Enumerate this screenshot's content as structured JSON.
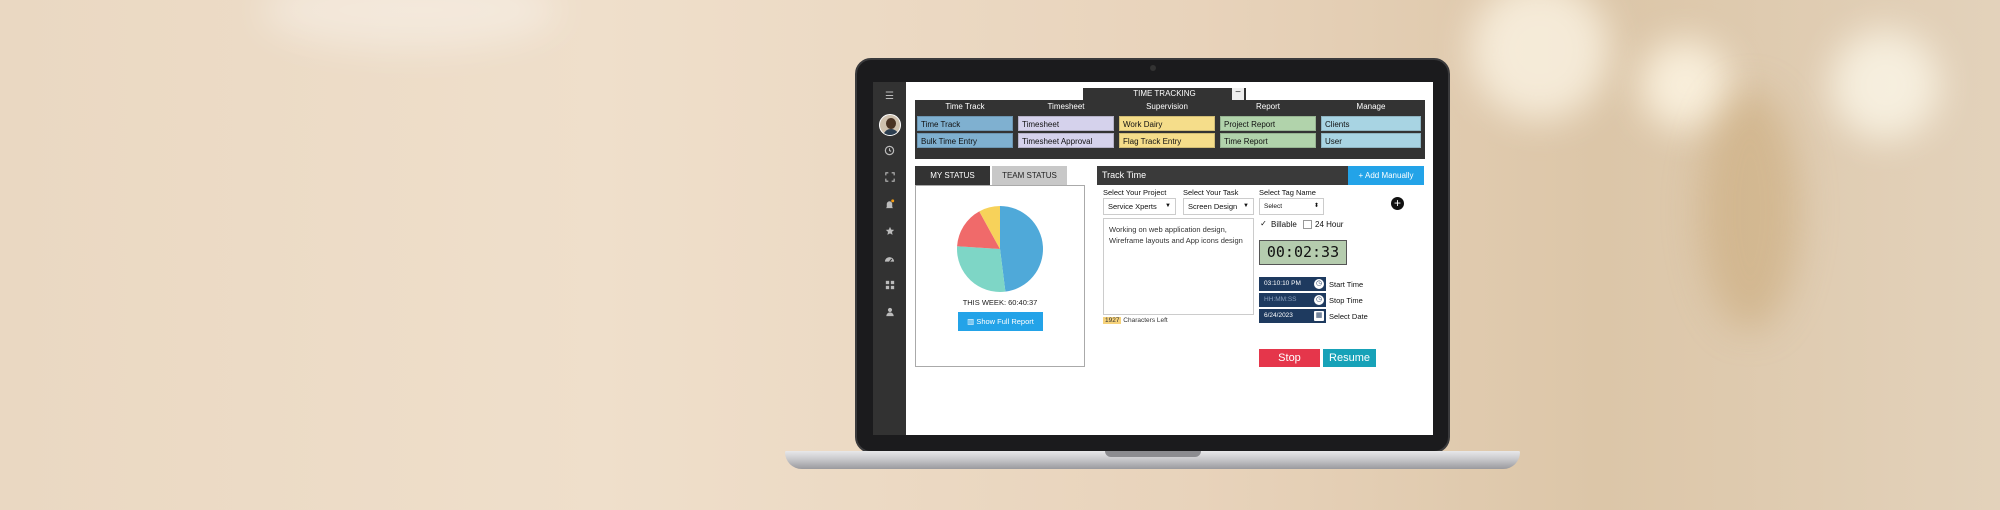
{
  "colors": {
    "accent_blue": "#23a3e8",
    "sidebar": "#323232",
    "stop": "#e5364b",
    "resume": "#17a2b8",
    "timer_bg": "#b5ccae"
  },
  "panel_title": "TIME TRACKING",
  "panel_minimize": "−",
  "sidebar": {
    "menu_icon": "☰",
    "icons": [
      "clock-icon",
      "expand-icon",
      "bell-icon",
      "star-icon",
      "dashboard-icon",
      "grid-icon",
      "user-icon"
    ]
  },
  "nav": [
    {
      "header": "Time Track",
      "color": "#7fb0d0",
      "items": [
        "Time Track",
        "Bulk Time Entry"
      ]
    },
    {
      "header": "Timesheet",
      "color": "#d5d2ec",
      "items": [
        "Timesheet",
        "Timesheet Approval"
      ]
    },
    {
      "header": "Supervision",
      "color": "#f5dd8a",
      "items": [
        "Work Dairy",
        "Flag Track Entry"
      ]
    },
    {
      "header": "Report",
      "color": "#b1d3ab",
      "items": [
        "Project Report",
        "Time Report"
      ]
    },
    {
      "header": "Manage",
      "color": "#a8d4e3",
      "items": [
        "Clients",
        "User"
      ]
    }
  ],
  "status": {
    "tabs": [
      "MY STATUS",
      "TEAM STATUS"
    ],
    "active_tab": "MY STATUS",
    "week_label": "THIS WEEK: 60:40:37",
    "report_button": "Show Full Report"
  },
  "chart_data": {
    "type": "pie",
    "slices": [
      {
        "share": 0.48,
        "color": "#4fa9d9"
      },
      {
        "share": 0.28,
        "color": "#7ed6c6"
      },
      {
        "share": 0.16,
        "color": "#f06a6a"
      },
      {
        "share": 0.08,
        "color": "#f7d25a"
      }
    ]
  },
  "track": {
    "title": "Track Time",
    "add_button": "Add Manually",
    "project_label": "Select Your Project",
    "project_value": "Service Xperts",
    "task_label": "Select Your Task",
    "task_value": "Screen Design",
    "tag_label": "Select Tag Name",
    "tag_value": "Select",
    "description": "Working on web application design, Wireframe layouts and App icons design",
    "chars_count": "1927",
    "chars_label": "Characters Left",
    "billable_label": "Billable",
    "billable_checked": true,
    "hour24_label": "24 Hour",
    "timer": "00:02:33",
    "start_time_value": "03:10:10 PM",
    "start_time_label": "Start Time",
    "stop_time_placeholder": "HH:MM:SS",
    "stop_time_label": "Stop Time",
    "date_value": "6/24/2023",
    "date_label": "Select Date",
    "stop_button": "Stop",
    "resume_button": "Resume"
  }
}
